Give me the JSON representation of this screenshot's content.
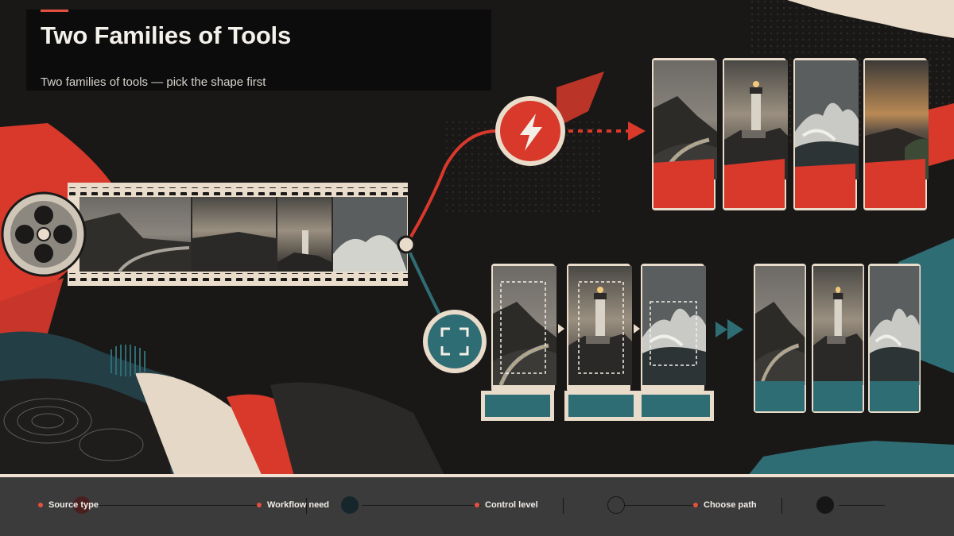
{
  "slide": {
    "title": "Two Families of Tools",
    "subtitle": "Two families of tools — pick the shape first"
  },
  "steps": [
    {
      "label": "Source type"
    },
    {
      "label": "Workflow need"
    },
    {
      "label": "Control level"
    },
    {
      "label": "Choose path"
    }
  ],
  "icons": {
    "fast_path": "lightning-bolt-icon",
    "control_path": "crop-frame-icon",
    "source": "film-reel-icon"
  },
  "colors": {
    "background": "#191817",
    "accent_red": "#d8392b",
    "accent_teal": "#2f6d74",
    "paper_cream": "#e9dccb",
    "bar": "#3b3b3b"
  }
}
